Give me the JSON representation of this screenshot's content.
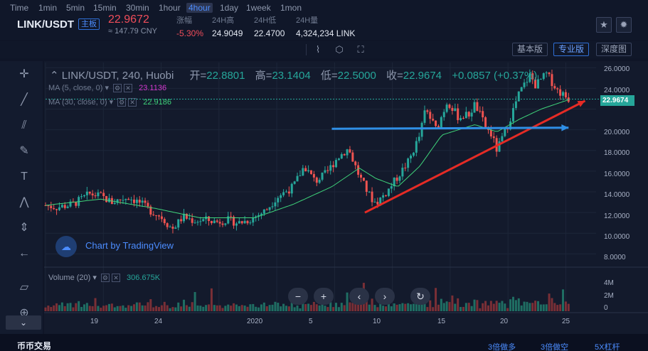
{
  "header": {
    "pair": "LINK/USDT",
    "board_badge": "主板",
    "last_price": "22.9672",
    "cny_price": "≈ 147.79 CNY",
    "stats": [
      {
        "label": "涨幅",
        "value": "-5.30%"
      },
      {
        "label": "24H高",
        "value": "24.9049"
      },
      {
        "label": "24H低",
        "value": "22.4700"
      },
      {
        "label": "24H量",
        "value": "4,324,234 LINK"
      }
    ],
    "icons": [
      "star-icon",
      "settings-icon"
    ]
  },
  "toolbar": {
    "intervals": [
      "Time",
      "1min",
      "5min",
      "15min",
      "30min",
      "1hour",
      "4hour",
      "1day",
      "1week",
      "1mon"
    ],
    "active_interval": "4hour",
    "views": [
      "基本版",
      "专业版",
      "深度图"
    ],
    "active_view": "专业版"
  },
  "legend": {
    "symbol": "LINK/USDT, 240, Huobi",
    "open_label": "开=",
    "open": "22.8801",
    "high_label": "高=",
    "high": "23.1404",
    "low_label": "低=",
    "low": "22.5000",
    "close_label": "收=",
    "close": "22.9674",
    "change": "+0.0857 (+0.37%)",
    "ma5_label": "MA (5, close, 0)",
    "ma5_value": "23.1136",
    "ma30_label": "MA (30, close, 0)",
    "ma30_value": "22.9186"
  },
  "volume": {
    "label": "Volume (20)",
    "value": "306.675K",
    "axis": [
      "4M",
      "2M",
      "0"
    ]
  },
  "watermark": "Chart by TradingView",
  "price_axis": [
    "26.0000",
    "24.0000",
    "22.9674",
    "20.0000",
    "18.0000",
    "16.0000",
    "14.0000",
    "12.0000",
    "10.0000",
    "8.0000"
  ],
  "time_axis": [
    "19",
    "24",
    "2020",
    "5",
    "10",
    "15",
    "20",
    "25"
  ],
  "chart_data": {
    "type": "candlestick",
    "price_range": [
      7,
      26.5
    ],
    "close_price": 22.9674,
    "price_path": [
      [
        0,
        12.7
      ],
      [
        2,
        12.5
      ],
      [
        5,
        12.8
      ],
      [
        8,
        13.8
      ],
      [
        10,
        13.6
      ],
      [
        12,
        13.0
      ],
      [
        15,
        13.5
      ],
      [
        17,
        13.0
      ],
      [
        19,
        12.2
      ],
      [
        21,
        11.6
      ],
      [
        23,
        10.4
      ],
      [
        25,
        11.6
      ],
      [
        27,
        11.2
      ],
      [
        29,
        11.3
      ],
      [
        31,
        11.1
      ],
      [
        33,
        11.3
      ],
      [
        35,
        11.0
      ],
      [
        37,
        11.3
      ],
      [
        40,
        12.2
      ],
      [
        42,
        13.5
      ],
      [
        45,
        14.5
      ],
      [
        47,
        16.5
      ],
      [
        49,
        15.0
      ],
      [
        51,
        15.8
      ],
      [
        53,
        17.3
      ],
      [
        55,
        18.2
      ],
      [
        57,
        15.5
      ],
      [
        59,
        13.5
      ],
      [
        60,
        12.9
      ],
      [
        62,
        14.0
      ],
      [
        64,
        15.5
      ],
      [
        66,
        17.0
      ],
      [
        68,
        19.5
      ],
      [
        69,
        22.0
      ],
      [
        71,
        20.0
      ],
      [
        73,
        22.8
      ],
      [
        75,
        21.2
      ],
      [
        77,
        21.5
      ],
      [
        78,
        22.5
      ],
      [
        80,
        20.2
      ],
      [
        81,
        19.5
      ],
      [
        82,
        18.0
      ],
      [
        84,
        20.5
      ],
      [
        86,
        23.5
      ],
      [
        88,
        25.3
      ],
      [
        89,
        24.3
      ],
      [
        91,
        25.4
      ],
      [
        93,
        23.8
      ],
      [
        95,
        23.0
      ]
    ],
    "ma30_path": [
      [
        0,
        12.7
      ],
      [
        10,
        13.3
      ],
      [
        20,
        12.4
      ],
      [
        28,
        11.5
      ],
      [
        38,
        11.5
      ],
      [
        45,
        12.8
      ],
      [
        52,
        14.5
      ],
      [
        57,
        16.3
      ],
      [
        60,
        15.3
      ],
      [
        64,
        14.5
      ],
      [
        68,
        16.5
      ],
      [
        72,
        19.5
      ],
      [
        78,
        20.5
      ],
      [
        82,
        19.8
      ],
      [
        86,
        21.0
      ],
      [
        90,
        22.0
      ],
      [
        95,
        22.9
      ]
    ],
    "annotations": [
      {
        "type": "red-arrow-trendline",
        "from": [
          58,
          12.0
        ],
        "to": [
          98,
          22.8
        ]
      },
      {
        "type": "blue-arrow-horizontal",
        "from": [
          52,
          20.1
        ],
        "to": [
          95,
          20.2
        ]
      }
    ]
  },
  "controls": [
    "zoom-out",
    "zoom-in",
    "scroll-left",
    "scroll-right",
    "reset"
  ],
  "bottom": {
    "title": "币币交易",
    "buttons": [
      "3倍做多",
      "3倍做空",
      "5X杠杆"
    ]
  }
}
